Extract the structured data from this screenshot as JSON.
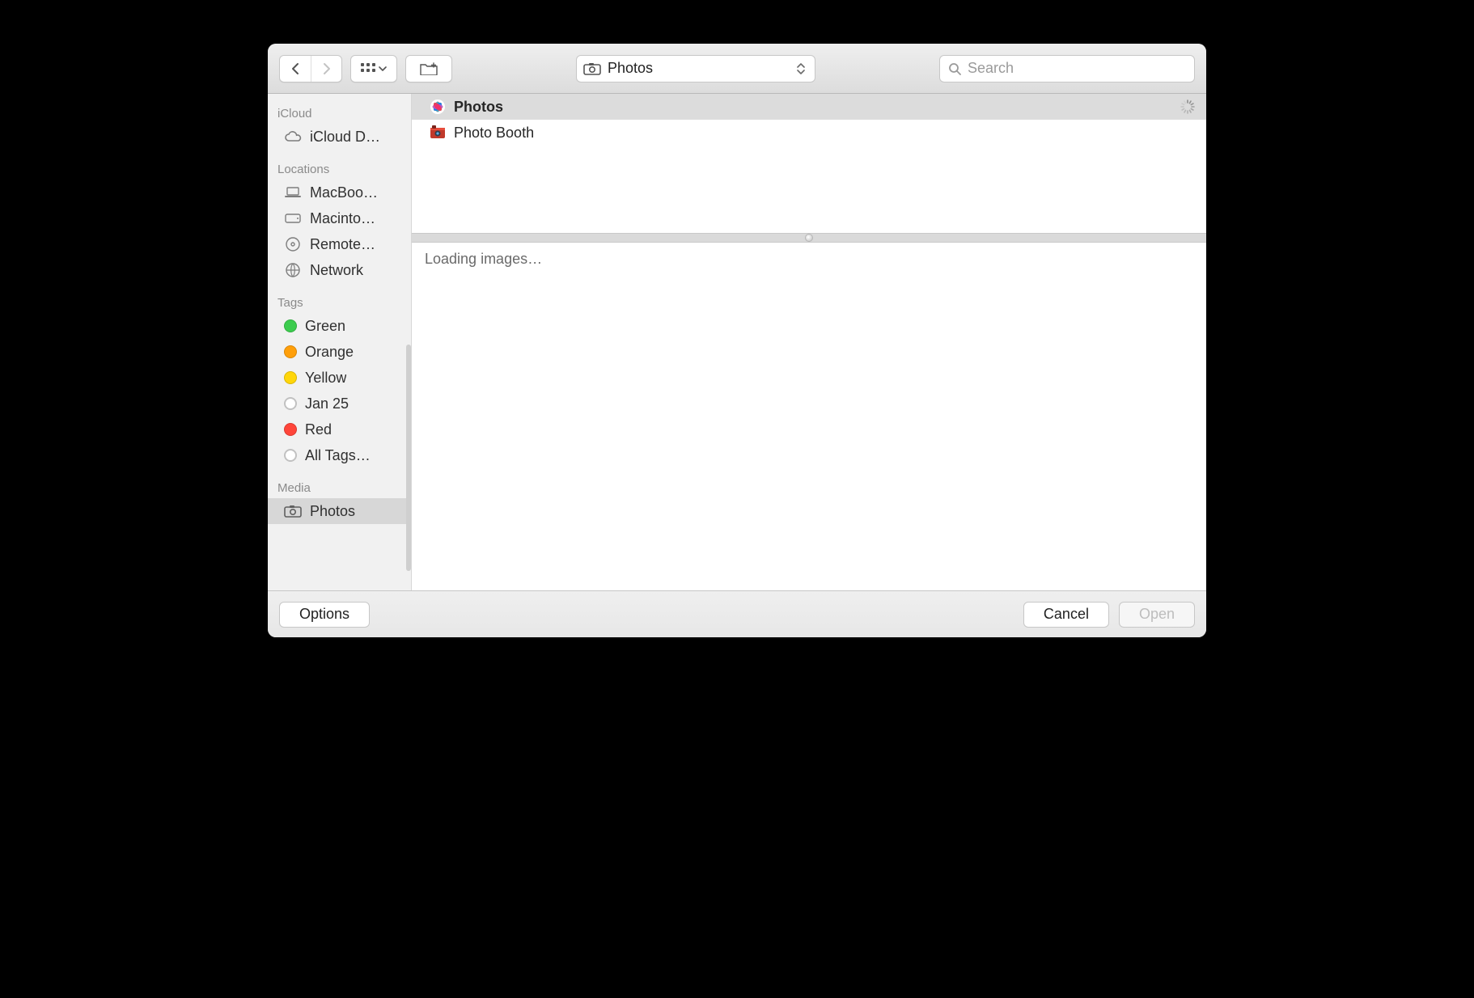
{
  "toolbar": {
    "location_label": "Photos",
    "search_placeholder": "Search"
  },
  "sidebar": {
    "sections": [
      {
        "title": "iCloud",
        "items": [
          {
            "label": "iCloud D…",
            "icon": "cloud-icon"
          }
        ]
      },
      {
        "title": "Locations",
        "items": [
          {
            "label": "MacBoo…",
            "icon": "laptop-icon"
          },
          {
            "label": "Macinto…",
            "icon": "hdd-icon"
          },
          {
            "label": "Remote…",
            "icon": "remote-disc-icon"
          },
          {
            "label": "Network",
            "icon": "globe-icon"
          }
        ]
      },
      {
        "title": "Tags",
        "items": [
          {
            "label": "Green",
            "tag_color": "green"
          },
          {
            "label": "Orange",
            "tag_color": "orange"
          },
          {
            "label": "Yellow",
            "tag_color": "yellow"
          },
          {
            "label": "Jan 25",
            "tag_color": "blank"
          },
          {
            "label": "Red",
            "tag_color": "red"
          },
          {
            "label": "All Tags…",
            "tag_color": "blank"
          }
        ]
      },
      {
        "title": "Media",
        "items": [
          {
            "label": "Photos",
            "icon": "camera-icon",
            "selected": true
          }
        ]
      }
    ]
  },
  "list": {
    "rows": [
      {
        "label": "Photos",
        "icon": "photos-app-icon",
        "selected": true,
        "loading": true
      },
      {
        "label": "Photo Booth",
        "icon": "photobooth-app-icon",
        "selected": false
      }
    ]
  },
  "preview": {
    "status_text": "Loading images…"
  },
  "footer": {
    "options_label": "Options",
    "cancel_label": "Cancel",
    "open_label": "Open"
  }
}
